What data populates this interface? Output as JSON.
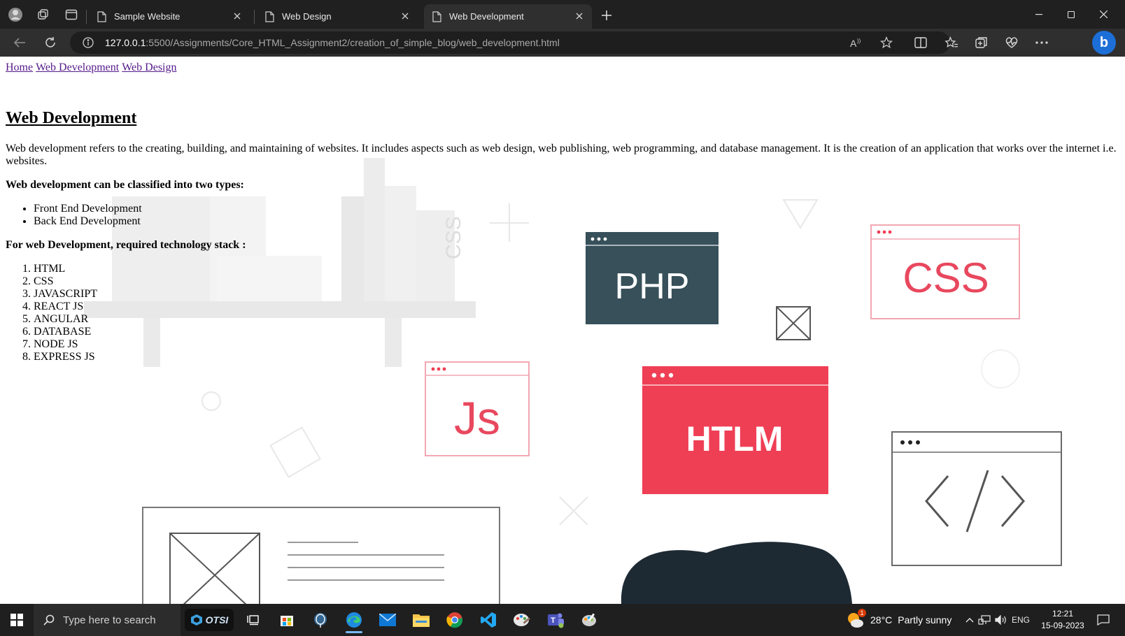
{
  "browser": {
    "tabs": [
      {
        "label": "Sample Website",
        "active": false
      },
      {
        "label": "Web Design",
        "active": false
      },
      {
        "label": "Web Development",
        "active": true
      }
    ],
    "url_host": "127.0.0.1",
    "url_path": ":5500/Assignments/Core_HTML_Assignment2/creation_of_simple_blog/web_development.html"
  },
  "page": {
    "nav": [
      "Home",
      "Web Development",
      "Web Design"
    ],
    "title": "Web Development",
    "intro": "Web development refers to the creating, building, and maintaining of websites. It includes aspects such as web design, web publishing, web programming, and database management. It is the creation of an application that works over the internet i.e. websites.",
    "types_heading": "Web development can be classified into two types:",
    "types": [
      "Front End Development",
      "Back End Development"
    ],
    "stack_heading": "For web Development, required technology stack :",
    "stack": [
      "HTML",
      "CSS",
      "JAVASCRIPT",
      "REACT JS",
      "ANGULAR",
      "DATABASE",
      "NODE JS",
      "EXPRESS JS"
    ],
    "background_art": {
      "php_label": "PHP",
      "css_label": "CSS",
      "js_label": "Js",
      "html_label": "HTLM",
      "shelf_book_label": "CSS",
      "php_color": "#37505a",
      "html_color": "#ef3f55"
    }
  },
  "taskbar": {
    "search_placeholder": "Type here to search",
    "otsi_label": "OTSI",
    "weather_temp": "28°C",
    "weather_desc": "Partly sunny",
    "weather_badge": "1",
    "language": "ENG",
    "time": "12:21",
    "date": "15-09-2023"
  }
}
